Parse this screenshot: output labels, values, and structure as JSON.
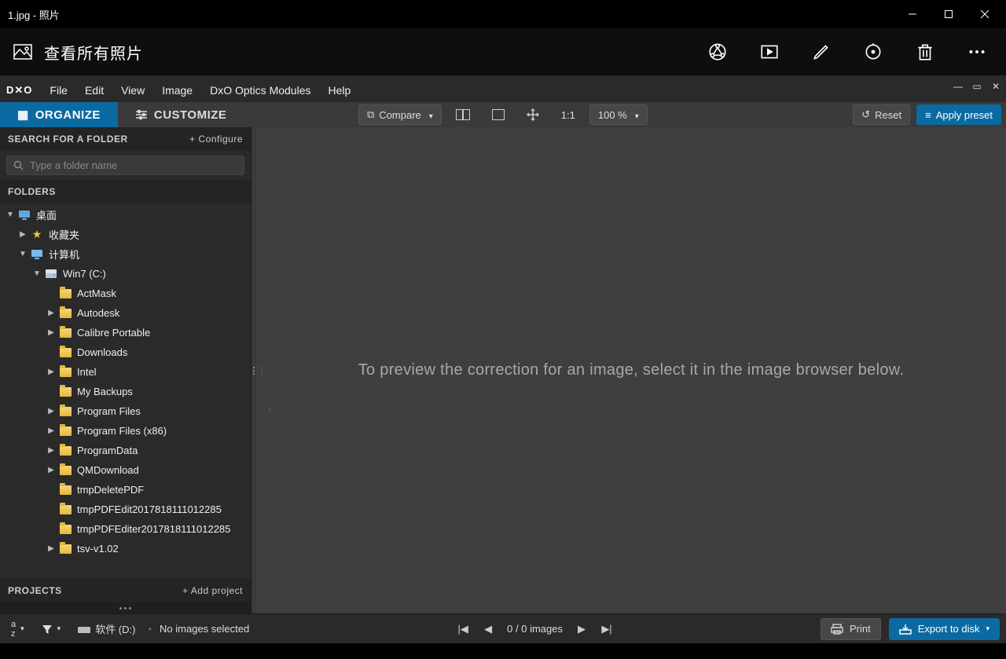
{
  "photos": {
    "title": "1.jpg - 照片",
    "view_all": "查看所有照片"
  },
  "dxo": {
    "menus": [
      "File",
      "Edit",
      "View",
      "Image",
      "DxO Optics Modules",
      "Help"
    ],
    "tabs": {
      "organize": "ORGANIZE",
      "customize": "CUSTOMIZE"
    },
    "toolbar": {
      "compare": "Compare",
      "one_to_one": "1:1",
      "zoom": "100 %",
      "reset": "Reset",
      "apply_preset": "Apply preset"
    },
    "sidebar": {
      "search_header": "SEARCH FOR A FOLDER",
      "configure": "+ Configure",
      "search_placeholder": "Type a folder name",
      "folders_header": "FOLDERS",
      "projects_header": "PROJECTS",
      "add_project": "+ Add project"
    },
    "tree": {
      "root": "桌面",
      "favorites": "收藏夹",
      "computer": "计算机",
      "drive": "Win7 (C:)",
      "folders": [
        {
          "name": "ActMask",
          "exp": false
        },
        {
          "name": "Autodesk",
          "exp": true
        },
        {
          "name": "Calibre Portable",
          "exp": true
        },
        {
          "name": "Downloads",
          "exp": false
        },
        {
          "name": "Intel",
          "exp": true
        },
        {
          "name": "My Backups",
          "exp": false
        },
        {
          "name": "Program Files",
          "exp": true
        },
        {
          "name": "Program Files (x86)",
          "exp": true
        },
        {
          "name": "ProgramData",
          "exp": true
        },
        {
          "name": "QMDownload",
          "exp": true
        },
        {
          "name": "tmpDeletePDF",
          "exp": false
        },
        {
          "name": "tmpPDFEdit2017818111012285",
          "exp": false
        },
        {
          "name": "tmpPDFEditer2017818111012285",
          "exp": false
        },
        {
          "name": "tsv-v1.02",
          "exp": true
        }
      ]
    },
    "preview_message": "To preview the correction for an image, select it in the image browser below.",
    "status": {
      "path": "软件 (D:)",
      "selection": "No images selected",
      "counter": "0 / 0  images",
      "print": "Print",
      "export": "Export to disk"
    }
  }
}
